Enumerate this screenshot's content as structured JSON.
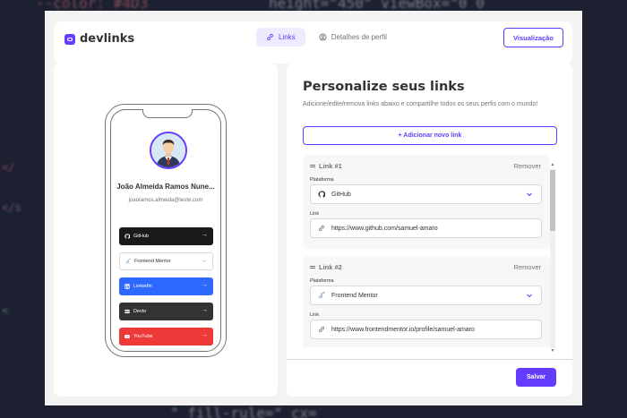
{
  "app": {
    "logo_text": "devlinks",
    "brand_color": "#633cff"
  },
  "nav": {
    "links_tab": "Links",
    "profile_tab": "Detalhes de perfil",
    "preview_button": "Visualização"
  },
  "preview": {
    "name": "João Almeida Ramos Nune...",
    "email": "joaoramos.almeida@teste.com",
    "links": [
      {
        "platform": "GitHub",
        "color": "#1a1a1a",
        "icon": "github-icon"
      },
      {
        "platform": "Frontend Mentor",
        "color": "#ffffff",
        "icon": "frontend-mentor-icon"
      },
      {
        "platform": "LinkedIn",
        "color": "#2d68ff",
        "icon": "linkedin-icon"
      },
      {
        "platform": "Devto",
        "color": "#333333",
        "icon": "devto-icon"
      },
      {
        "platform": "YouTube",
        "color": "#ee3939",
        "icon": "youtube-icon"
      }
    ]
  },
  "editor": {
    "title": "Personalize seus links",
    "subtitle": "Adicione/edite/remova links abaixo e compartilhe todos os seus perfis com o mundo!",
    "add_button": "+ Adicionar novo link",
    "platform_label": "Plataforma",
    "link_label": "Link",
    "remove_label": "Remover",
    "links": [
      {
        "heading": "Link #1",
        "platform": "GitHub",
        "url": "https://www.github.com/samuel-amaro"
      },
      {
        "heading": "Link #2",
        "platform": "Frontend Mentor",
        "url": "https://www.frontendmentor.io/profile/samuel-amaro"
      }
    ],
    "save_button": "Salvar"
  },
  "backdrop": {
    "code_top_1": "--color: #4D3",
    "code_top_2": "height=\"450\" viewBox=\"0 0 ",
    "code_bottom_1": "\" fill-rule=\" cx=",
    "code_bottom_2": "",
    "code_left_1": "</",
    "code_left_2": "</s",
    "code_left_3": "<",
    "code_right_1": "",
    "code_right_2": ""
  }
}
